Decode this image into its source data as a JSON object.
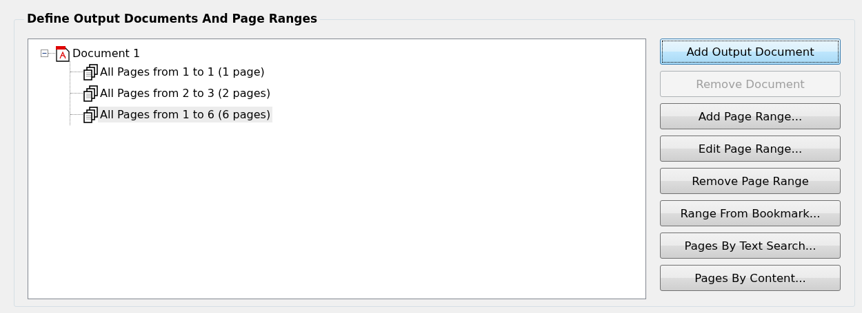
{
  "group": {
    "title": "Define Output Documents And Page Ranges"
  },
  "tree": [
    {
      "label": "Document 1",
      "kind": "pdf",
      "expanded": true,
      "selected": false,
      "children": [
        {
          "label": "All Pages from 1 to 1 (1 page)",
          "kind": "range",
          "selected": false
        },
        {
          "label": "All Pages from 2 to 3 (2 pages)",
          "kind": "range",
          "selected": false
        },
        {
          "label": "All Pages from 1 to 6 (6 pages)",
          "kind": "range",
          "selected": true
        }
      ]
    }
  ],
  "buttons": [
    {
      "label": "Add Output Document",
      "focused": true,
      "disabled": false
    },
    {
      "label": "Remove Document",
      "focused": false,
      "disabled": true
    },
    {
      "label": "Add Page Range...",
      "focused": false,
      "disabled": false
    },
    {
      "label": "Edit Page Range...",
      "focused": false,
      "disabled": false
    },
    {
      "label": "Remove Page Range",
      "focused": false,
      "disabled": false
    },
    {
      "label": "Range From Bookmark...",
      "focused": false,
      "disabled": false
    },
    {
      "label": "Pages By Text Search...",
      "focused": false,
      "disabled": false
    },
    {
      "label": "Pages By Content...",
      "focused": false,
      "disabled": false
    }
  ]
}
